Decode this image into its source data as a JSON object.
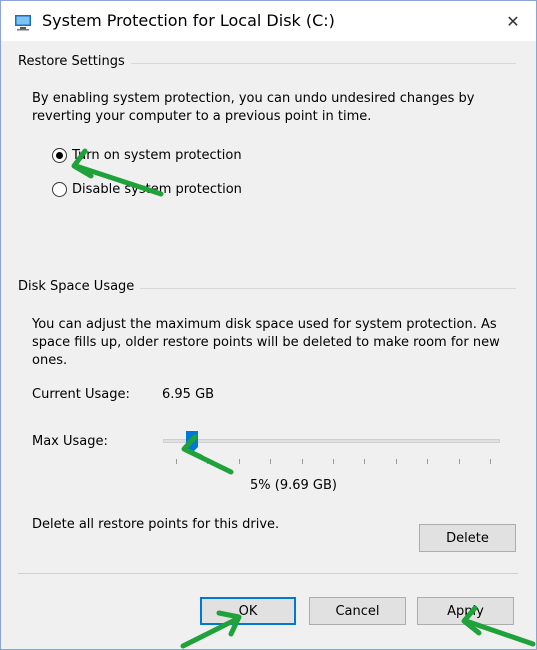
{
  "window": {
    "title": "System Protection for Local Disk (C:)",
    "close_glyph": "✕"
  },
  "restore_settings": {
    "group_label": "Restore Settings",
    "description": "By enabling system protection, you can undo undesired changes by reverting your computer to a previous point in time.",
    "options": [
      {
        "label": "Turn on system protection",
        "selected": true
      },
      {
        "label": "Disable system protection",
        "selected": false
      }
    ]
  },
  "disk_space_usage": {
    "group_label": "Disk Space Usage",
    "description": "You can adjust the maximum disk space used for system protection. As space fills up, older restore points will be deleted to make room for new ones.",
    "current_usage_label": "Current Usage:",
    "current_usage_value": "6.95 GB",
    "max_usage_label": "Max Usage:",
    "max_usage_percent": 5,
    "max_usage_value": "5% (9.69 GB)",
    "delete_text": "Delete all restore points for this drive.",
    "delete_button": "Delete"
  },
  "buttons": {
    "ok": "OK",
    "cancel": "Cancel",
    "apply": "Apply"
  },
  "colors": {
    "accent": "#0078d7",
    "annotation_arrow": "#1fa23a"
  },
  "icons": {
    "title": "system-properties-icon",
    "close": "close-icon",
    "slider_thumb": "slider-thumb"
  }
}
